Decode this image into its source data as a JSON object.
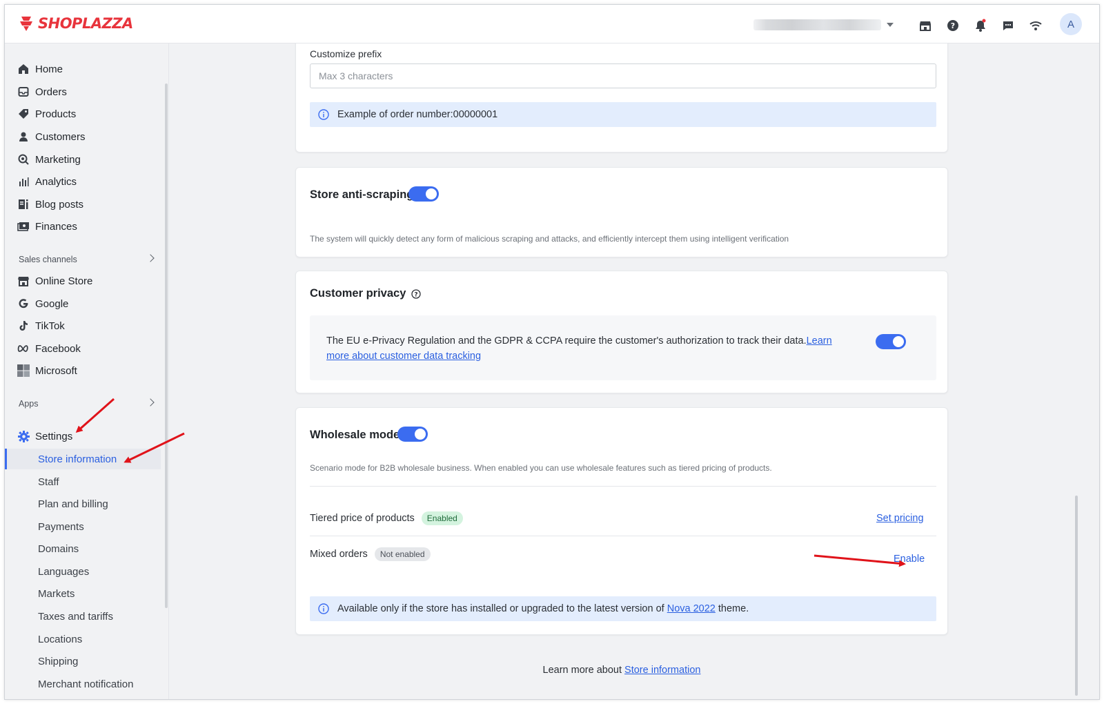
{
  "brand": {
    "name": "SHOPLAZZA",
    "color": "#e8343c"
  },
  "header": {
    "store_selector_icon": "chevron-down-icon",
    "icons": [
      "store-icon",
      "help-icon",
      "bell-icon",
      "chat-icon",
      "wifi-icon"
    ],
    "avatar_initial": "A"
  },
  "sidebar": {
    "items": [
      {
        "label": "Home",
        "icon": "home-icon"
      },
      {
        "label": "Orders",
        "icon": "inbox-icon"
      },
      {
        "label": "Products",
        "icon": "tag-icon"
      },
      {
        "label": "Customers",
        "icon": "person-icon"
      },
      {
        "label": "Marketing",
        "icon": "marketing-icon"
      },
      {
        "label": "Analytics",
        "icon": "bar-chart-icon"
      },
      {
        "label": "Blog posts",
        "icon": "blog-icon"
      },
      {
        "label": "Finances",
        "icon": "finance-icon"
      }
    ],
    "sales_channels_label": "Sales channels",
    "channels": [
      {
        "label": "Online Store",
        "icon": "store-icon"
      },
      {
        "label": "Google",
        "icon": "google-icon"
      },
      {
        "label": "TikTok",
        "icon": "tiktok-icon"
      },
      {
        "label": "Facebook",
        "icon": "meta-icon"
      },
      {
        "label": "Microsoft",
        "icon": "microsoft-icon"
      }
    ],
    "apps_label": "Apps",
    "settings_label": "Settings",
    "settings_items": [
      "Store information",
      "Staff",
      "Plan and billing",
      "Payments",
      "Domains",
      "Languages",
      "Markets",
      "Taxes and tariffs",
      "Locations",
      "Shipping",
      "Merchant notification"
    ],
    "active_item": "Store information"
  },
  "order_prefix": {
    "label": "Customize prefix",
    "placeholder": "Max 3 characters",
    "value": "",
    "example": "Example of order number:00000001"
  },
  "anti_scraping": {
    "title": "Store anti-scraping",
    "enabled": true,
    "description": "The system will quickly detect any form of malicious scraping and attacks, and efficiently intercept them using intelligent verification"
  },
  "privacy": {
    "title": "Customer privacy",
    "text": "The EU e-Privacy Regulation and the GDPR & CCPA require the customer's authorization to track their data.",
    "link": "Learn more about customer data tracking",
    "enabled": true
  },
  "wholesale": {
    "title": "Wholesale mode",
    "enabled": true,
    "description": "Scenario mode for B2B wholesale business. When enabled you can use wholesale features such as tiered pricing of products.",
    "rows": [
      {
        "label": "Tiered price of products",
        "status": "Enabled",
        "action": "Set pricing"
      },
      {
        "label": "Mixed orders",
        "status": "Not enabled",
        "action": "Enable"
      }
    ],
    "notice_prefix": "Available only if the store has installed or upgraded to the latest version of",
    "notice_link": "Nova 2022",
    "notice_suffix": "theme."
  },
  "footer": {
    "prefix": "Learn more about",
    "link": "Store information"
  },
  "colors": {
    "accent": "#3b6cf0",
    "link": "#2a5fe0",
    "annotation": "#e0131a"
  }
}
